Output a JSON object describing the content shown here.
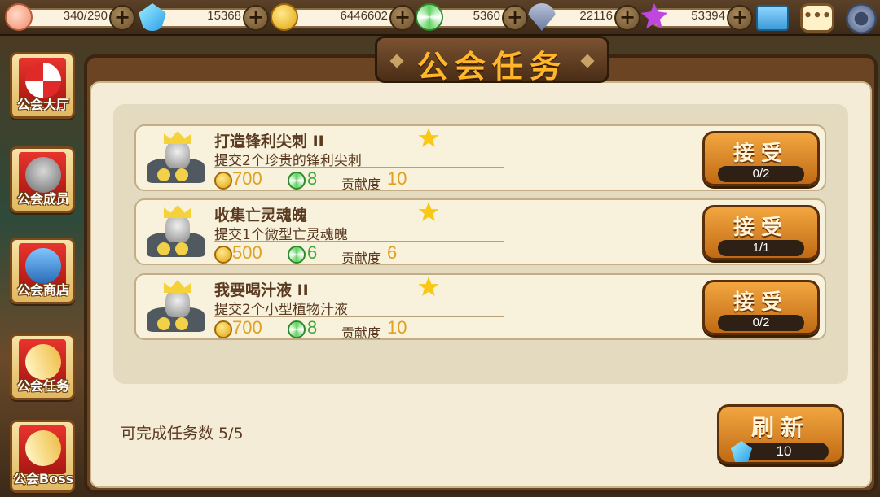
{
  "resources": [
    {
      "name": "stamina",
      "icon": "meat-icon",
      "value": "340/290"
    },
    {
      "name": "gems",
      "icon": "gem-icon",
      "value": "15368"
    },
    {
      "name": "gold",
      "icon": "coin-icon",
      "value": "6446602"
    },
    {
      "name": "candy",
      "icon": "candy-icon",
      "value": "5360"
    },
    {
      "name": "honor",
      "icon": "shield-icon",
      "value": "22116"
    },
    {
      "name": "stars",
      "icon": "star-icon",
      "value": "53394"
    }
  ],
  "topbar_icons": {
    "mail": "mail-icon",
    "chat": "chat-icon",
    "settings": "gear-icon",
    "chat_glyph": "•••"
  },
  "sidenav": [
    {
      "label": "公会大厅",
      "icon": "tent-icon"
    },
    {
      "label": "公会成员",
      "icon": "helmet-icon"
    },
    {
      "label": "公会商店",
      "icon": "chest-icon"
    },
    {
      "label": "公会任务",
      "icon": "scroll-icon"
    },
    {
      "label": "公会Boss",
      "icon": "scroll-icon"
    }
  ],
  "panel": {
    "title": "公会任务"
  },
  "tasks": [
    {
      "name": "打造锋利尖刺 II",
      "desc": "提交2个珍贵的锋利尖刺",
      "gold": "700",
      "candy": "8",
      "contrib_label": "贡献度",
      "contrib": "10",
      "accept_label": "接受",
      "progress": "0/2"
    },
    {
      "name": "收集亡灵魂魄",
      "desc": "提交1个微型亡灵魂魄",
      "gold": "500",
      "candy": "6",
      "contrib_label": "贡献度",
      "contrib": "6",
      "accept_label": "接受",
      "progress": "1/1"
    },
    {
      "name": "我要喝汁液 II",
      "desc": "提交2个小型植物汁液",
      "gold": "700",
      "candy": "8",
      "contrib_label": "贡献度",
      "contrib": "10",
      "accept_label": "接受",
      "progress": "0/2"
    }
  ],
  "footer": {
    "completable": "可完成任务数 5/5"
  },
  "refresh": {
    "label": "刷新",
    "cost": "10"
  }
}
